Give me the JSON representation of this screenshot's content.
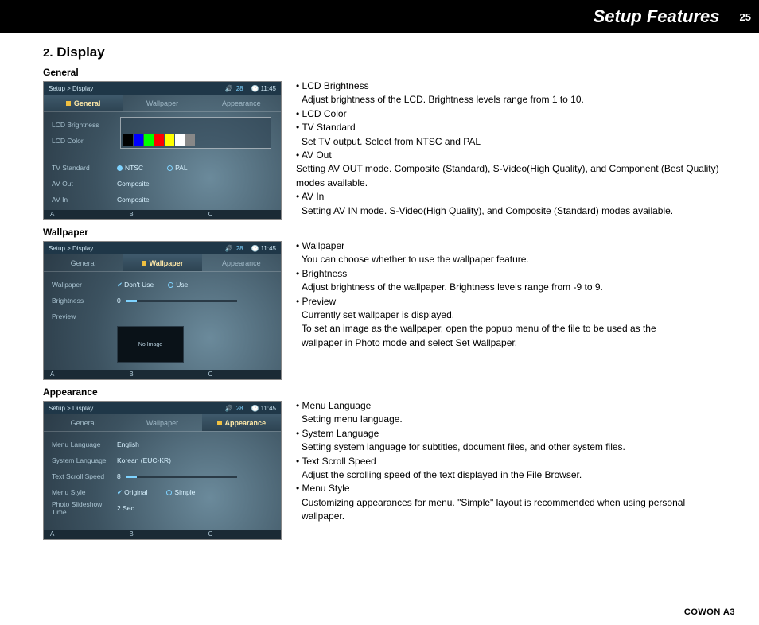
{
  "header": {
    "title": "Setup Features",
    "page": "25"
  },
  "section": {
    "number": "2.",
    "title": "Display"
  },
  "footer": "COWON A3",
  "screens": {
    "common": {
      "breadcrumb": "Setup > Display",
      "volume": "28",
      "vol_icon": "🔊",
      "clock_icon": "🕐",
      "time": "11:45",
      "bottom_a": "A",
      "bottom_b": "B",
      "bottom_c": "C"
    },
    "general": {
      "label": "General",
      "tabs": [
        "General",
        "Wallpaper",
        "Appearance"
      ],
      "active": 0,
      "rows": [
        {
          "lbl": "LCD Brightness",
          "val": ""
        },
        {
          "lbl": "LCD Color",
          "val": ""
        },
        {
          "lbl": "TV Standard",
          "val_a": "NTSC",
          "val_b": "PAL"
        },
        {
          "lbl": "AV Out",
          "val": "Composite"
        },
        {
          "lbl": "AV In",
          "val": "Composite"
        }
      ]
    },
    "wallpaper": {
      "label": "Wallpaper",
      "tabs": [
        "General",
        "Wallpaper",
        "Appearance"
      ],
      "active": 1,
      "rows": [
        {
          "lbl": "Wallpaper",
          "val_a": "Don't Use",
          "val_b": "Use"
        },
        {
          "lbl": "Brightness",
          "val": "0"
        },
        {
          "lbl": "Preview",
          "val": ""
        }
      ],
      "no_image": "No Image"
    },
    "appearance": {
      "label": "Appearance",
      "tabs": [
        "General",
        "Wallpaper",
        "Appearance"
      ],
      "active": 2,
      "rows": [
        {
          "lbl": "Menu Language",
          "val": "English"
        },
        {
          "lbl": "System Language",
          "val": "Korean (EUC-KR)"
        },
        {
          "lbl": "Text Scroll Speed",
          "val": "8"
        },
        {
          "lbl": "Menu Style",
          "val_a": "Original",
          "val_b": "Simple"
        },
        {
          "lbl": "Photo Slideshow Time",
          "val": "2 Sec."
        }
      ]
    }
  },
  "descriptions": {
    "general": [
      {
        "t": "LCD Brightness",
        "d": "Adjust brightness of the LCD. Brightness levels range from 1 to 10."
      },
      {
        "t": "LCD Color",
        "d": ""
      },
      {
        "t": "TV Standard",
        "d": "Set TV output. Select from NTSC and PAL"
      },
      {
        "t": "AV Out",
        "d": "Setting AV OUT mode. Composite (Standard), S-Video(High Quality), and Component (Best Quality) modes available."
      },
      {
        "t": "AV In",
        "d": "Setting AV IN mode. S-Video(High Quality), and Composite (Standard) modes available."
      }
    ],
    "wallpaper": [
      {
        "t": "Wallpaper",
        "d": "You can choose whether to use the wallpaper feature."
      },
      {
        "t": "Brightness",
        "d": "Adjust brightness of the wallpaper. Brightness levels range from -9 to 9."
      },
      {
        "t": "Preview",
        "d": "Currently set wallpaper is displayed."
      }
    ],
    "wallpaper_extra": [
      "To set an image as the wallpaper, open the popup menu of the file to be used as the",
      "wallpaper in Photo mode and select Set Wallpaper."
    ],
    "appearance": [
      {
        "t": "Menu Language",
        "d": "Setting menu language."
      },
      {
        "t": "System Language",
        "d": "Setting system language for subtitles, document files, and other system files."
      },
      {
        "t": "Text Scroll Speed",
        "d": "Adjust the scrolling speed of the text displayed in the File Browser."
      },
      {
        "t": "Menu Style",
        "d": "Customizing appearances for menu.  \"Simple\" layout is recommended when using personal wallpaper."
      }
    ]
  }
}
